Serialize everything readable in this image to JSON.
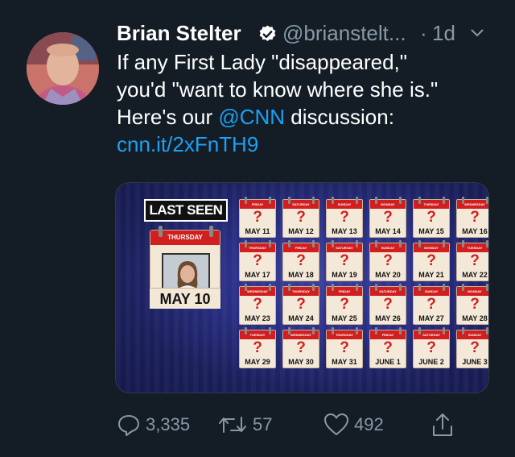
{
  "tweet": {
    "author_name": "Brian Stelter",
    "handle": "@brianstelt...",
    "separator": "·",
    "time": "1d",
    "text_lines": [
      "If any First Lady \"disappeared,\"",
      "you'd \"want to know where she is.\""
    ],
    "line3_prefix": "Here's our ",
    "mention": "@CNN",
    "line3_suffix": " discussion:",
    "link": "cnn.it/2xFnTH9"
  },
  "media": {
    "last_seen_label": "LAST SEEN",
    "big_calendar_day": "THURSDAY",
    "big_calendar_date": "MAY 10",
    "question_mark": "?",
    "calendars": [
      {
        "day": "FRIDAY",
        "date": "MAY 11"
      },
      {
        "day": "SATURDAY",
        "date": "MAY 12"
      },
      {
        "day": "SUNDAY",
        "date": "MAY 13"
      },
      {
        "day": "MONDAY",
        "date": "MAY 14"
      },
      {
        "day": "TUESDAY",
        "date": "MAY 15"
      },
      {
        "day": "WEDNESDAY",
        "date": "MAY 16"
      },
      {
        "day": "THURSDAY",
        "date": "MAY 17"
      },
      {
        "day": "FRIDAY",
        "date": "MAY 18"
      },
      {
        "day": "SATURDAY",
        "date": "MAY 19"
      },
      {
        "day": "SUNDAY",
        "date": "MAY 20"
      },
      {
        "day": "MONDAY",
        "date": "MAY 21"
      },
      {
        "day": "TUESDAY",
        "date": "MAY 22"
      },
      {
        "day": "WEDNESDAY",
        "date": "MAY 23"
      },
      {
        "day": "THURSDAY",
        "date": "MAY 24"
      },
      {
        "day": "FRIDAY",
        "date": "MAY 25"
      },
      {
        "day": "SATURDAY",
        "date": "MAY 26"
      },
      {
        "day": "SUNDAY",
        "date": "MAY 27"
      },
      {
        "day": "MONDAY",
        "date": "MAY 28"
      },
      {
        "day": "TUESDAY",
        "date": "MAY 29"
      },
      {
        "day": "WEDNESDAY",
        "date": "MAY 30"
      },
      {
        "day": "THURSDAY",
        "date": "MAY 31"
      },
      {
        "day": "FRIDAY",
        "date": "JUNE 1"
      },
      {
        "day": "SATURDAY",
        "date": "JUNE 2"
      },
      {
        "day": "SUNDAY",
        "date": "JUNE 3"
      }
    ]
  },
  "actions": {
    "replies": "3,335",
    "retweets": "57",
    "likes": "492"
  },
  "icons": {
    "verified": "verified-badge-icon",
    "chevron": "chevron-down-icon",
    "reply": "reply-icon",
    "retweet": "retweet-icon",
    "like": "heart-icon",
    "share": "share-icon"
  },
  "colors": {
    "background": "#141d26",
    "link": "#1da1f2",
    "muted": "#8899a6",
    "calendar_red": "#d11f1f"
  }
}
